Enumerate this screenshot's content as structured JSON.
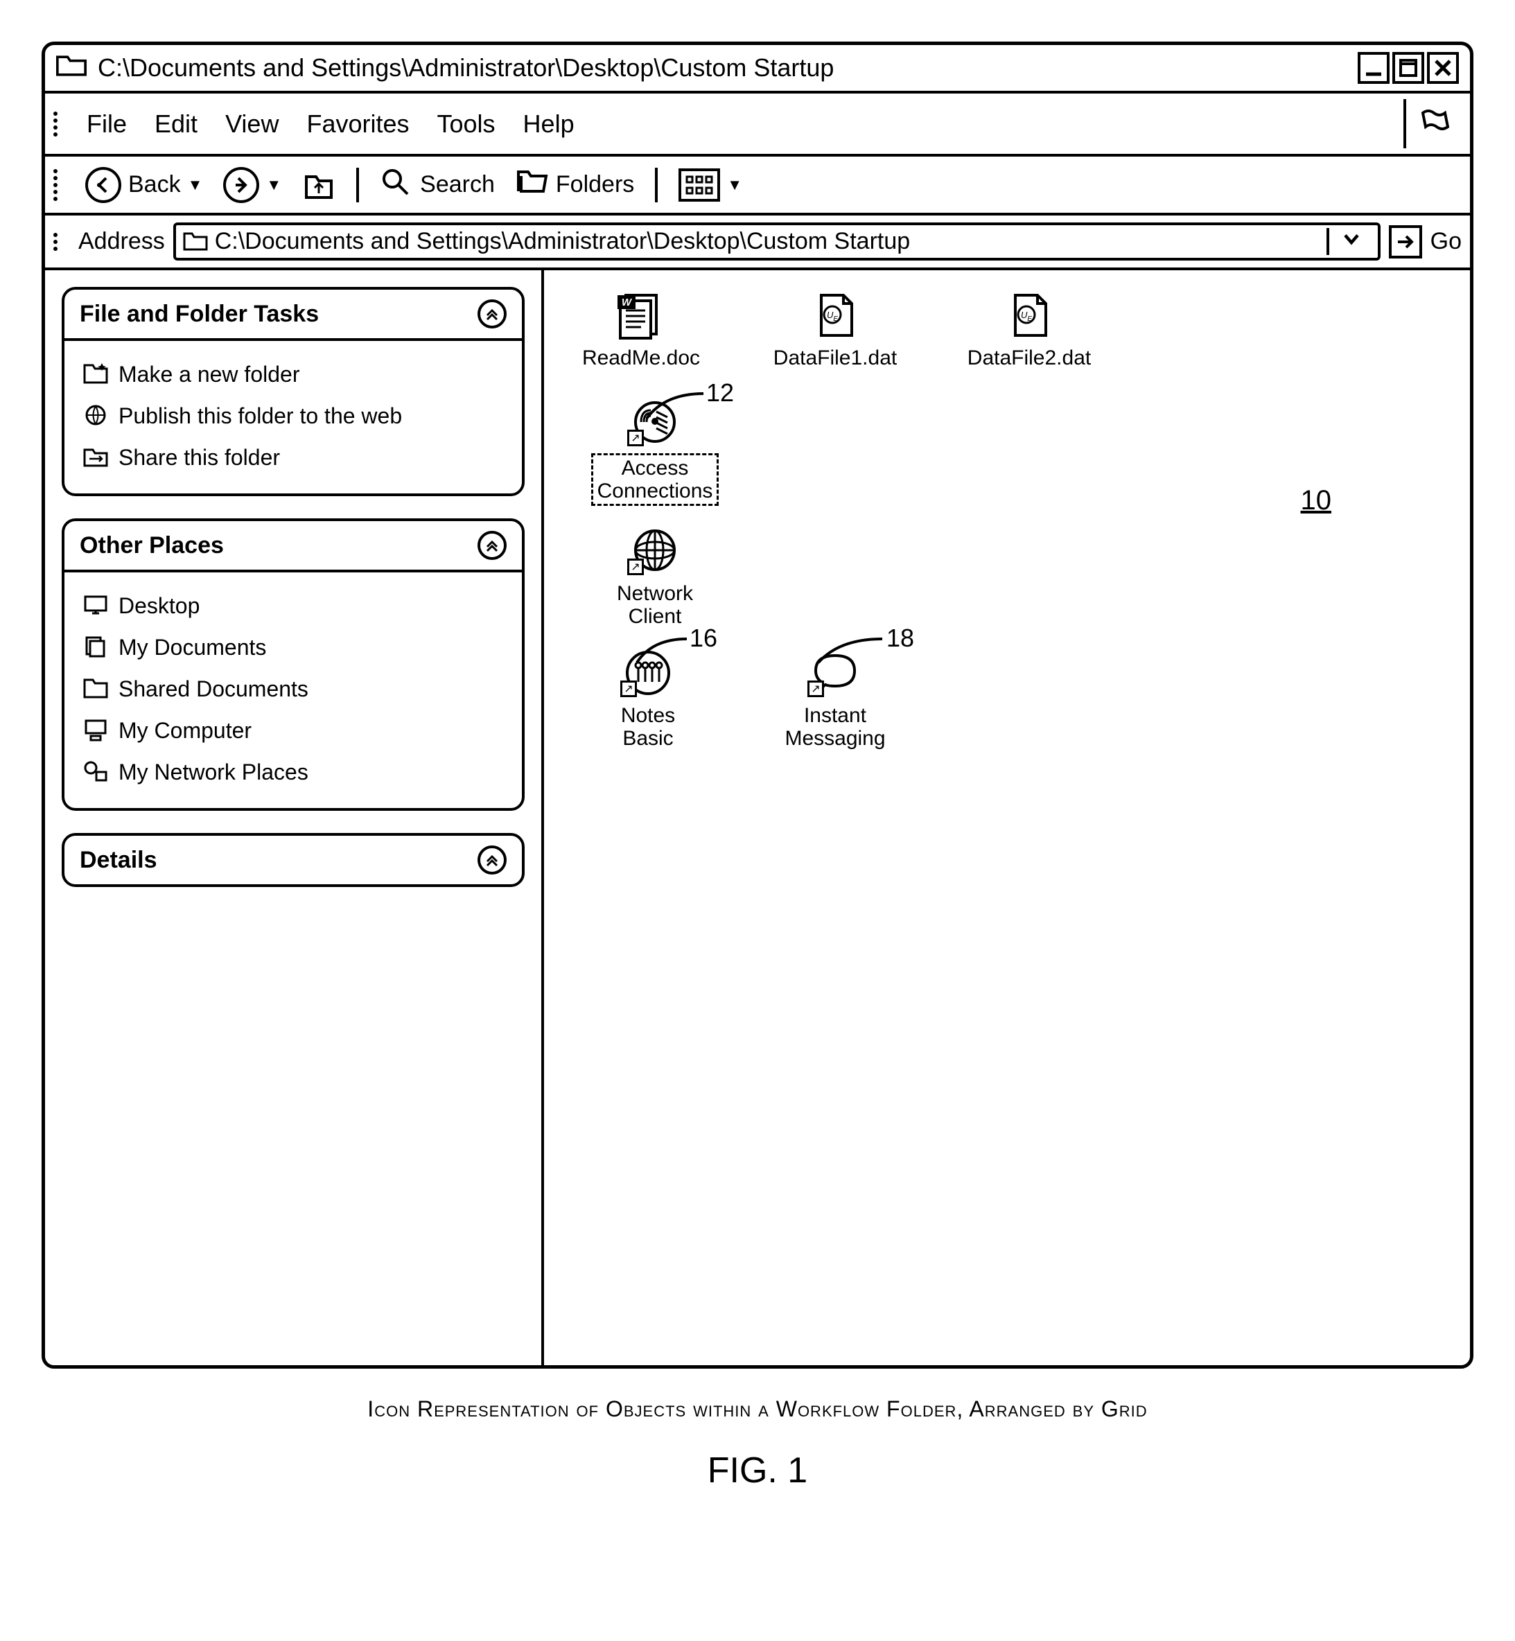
{
  "window": {
    "path": "C:\\Documents and Settings\\Administrator\\Desktop\\Custom Startup"
  },
  "menu": {
    "items": [
      "File",
      "Edit",
      "View",
      "Favorites",
      "Tools",
      "Help"
    ]
  },
  "toolbar": {
    "back": "Back",
    "search": "Search",
    "folders": "Folders"
  },
  "address": {
    "label": "Address",
    "value": "C:\\Documents and Settings\\Administrator\\Desktop\\Custom Startup",
    "go": "Go"
  },
  "sidebar": {
    "panels": [
      {
        "title": "File and Folder Tasks",
        "items": [
          {
            "icon": "folder-open",
            "label": "Make a new folder"
          },
          {
            "icon": "publish",
            "label": "Publish this folder to the web"
          },
          {
            "icon": "share",
            "label": "Share this folder"
          }
        ]
      },
      {
        "title": "Other Places",
        "items": [
          {
            "icon": "desktop",
            "label": "Desktop"
          },
          {
            "icon": "documents",
            "label": "My Documents"
          },
          {
            "icon": "folder",
            "label": "Shared Documents"
          },
          {
            "icon": "computer",
            "label": "My Computer"
          },
          {
            "icon": "network",
            "label": "My Network Places"
          }
        ]
      },
      {
        "title": "Details",
        "items": []
      }
    ]
  },
  "files": {
    "row1": [
      {
        "name": "ReadMe.doc",
        "type": "doc"
      },
      {
        "name": "DataFile1.dat",
        "type": "dat"
      },
      {
        "name": "DataFile2.dat",
        "type": "dat"
      }
    ],
    "access": {
      "label1": "Access",
      "label2": "Connections",
      "ref": "12"
    },
    "netclient": {
      "label1": "Network",
      "label2": "Client"
    },
    "notes": {
      "label1": "Notes",
      "label2": "Basic",
      "ref": "16"
    },
    "im": {
      "label1": "Instant",
      "label2": "Messaging",
      "ref": "18"
    },
    "ref10": "10"
  },
  "caption": "Icon Representation of Objects within a Workflow Folder, Arranged by Grid",
  "figure": "FIG. 1"
}
